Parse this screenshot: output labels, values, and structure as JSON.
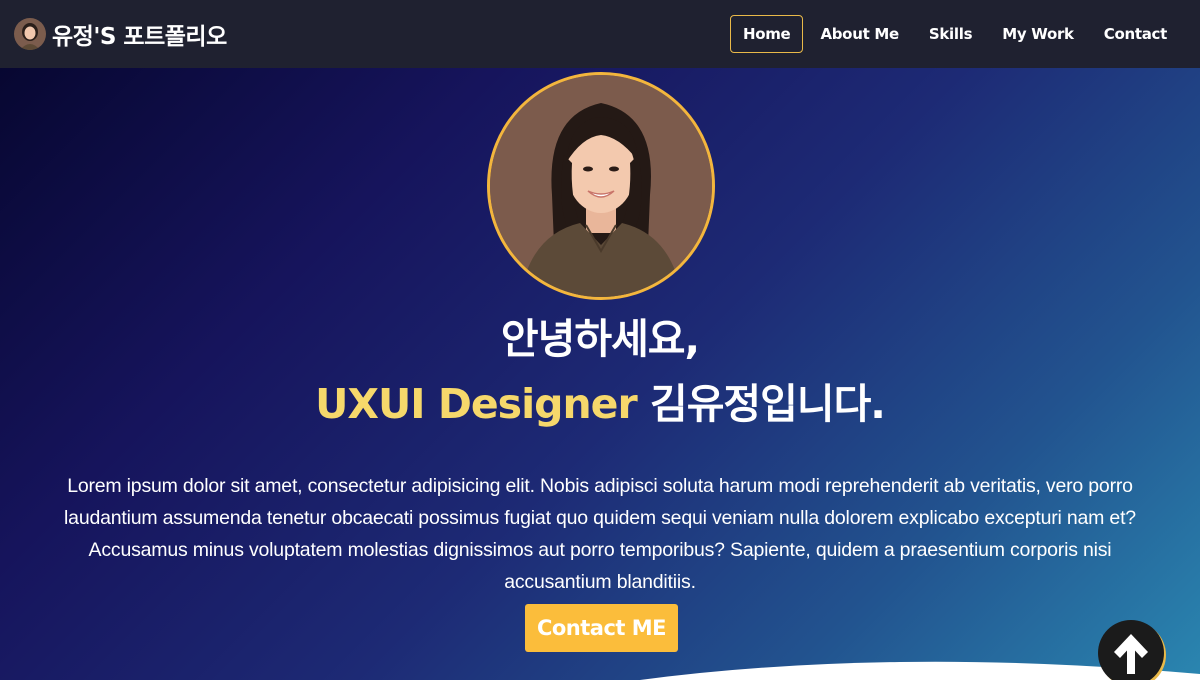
{
  "brand": {
    "title": "유정'S 포트폴리오",
    "avatar_icon": "profile-avatar-icon"
  },
  "nav": {
    "items": [
      {
        "label": "Home",
        "active": true
      },
      {
        "label": "About Me",
        "active": false
      },
      {
        "label": "Skills",
        "active": false
      },
      {
        "label": "My Work",
        "active": false
      },
      {
        "label": "Contact",
        "active": false
      }
    ]
  },
  "hero": {
    "greeting": "안녕하세요,",
    "title_highlight": "UXUI Designer",
    "title_rest": " 김유정입니다.",
    "intro": "Lorem ipsum dolor sit amet, consectetur adipisicing elit. Nobis adipisci soluta harum modi reprehenderit ab veritatis, vero porro laudantium assumenda tenetur obcaecati possimus fugiat quo quidem sequi veniam nulla dolorem explicabo excepturi nam et? Accusamus minus voluptatem molestias dignissimos aut porro temporibus? Sapiente, quidem a praesentium corporis nisi accusantium blanditiis.",
    "contact_button": "Contact ME"
  },
  "scroll_top": {
    "icon": "arrow-up-icon"
  },
  "colors": {
    "navbar_bg": "#1f2130",
    "accent": "#fbbd3b",
    "highlight_text": "#f6d86b",
    "active_border": "#e9b949"
  }
}
